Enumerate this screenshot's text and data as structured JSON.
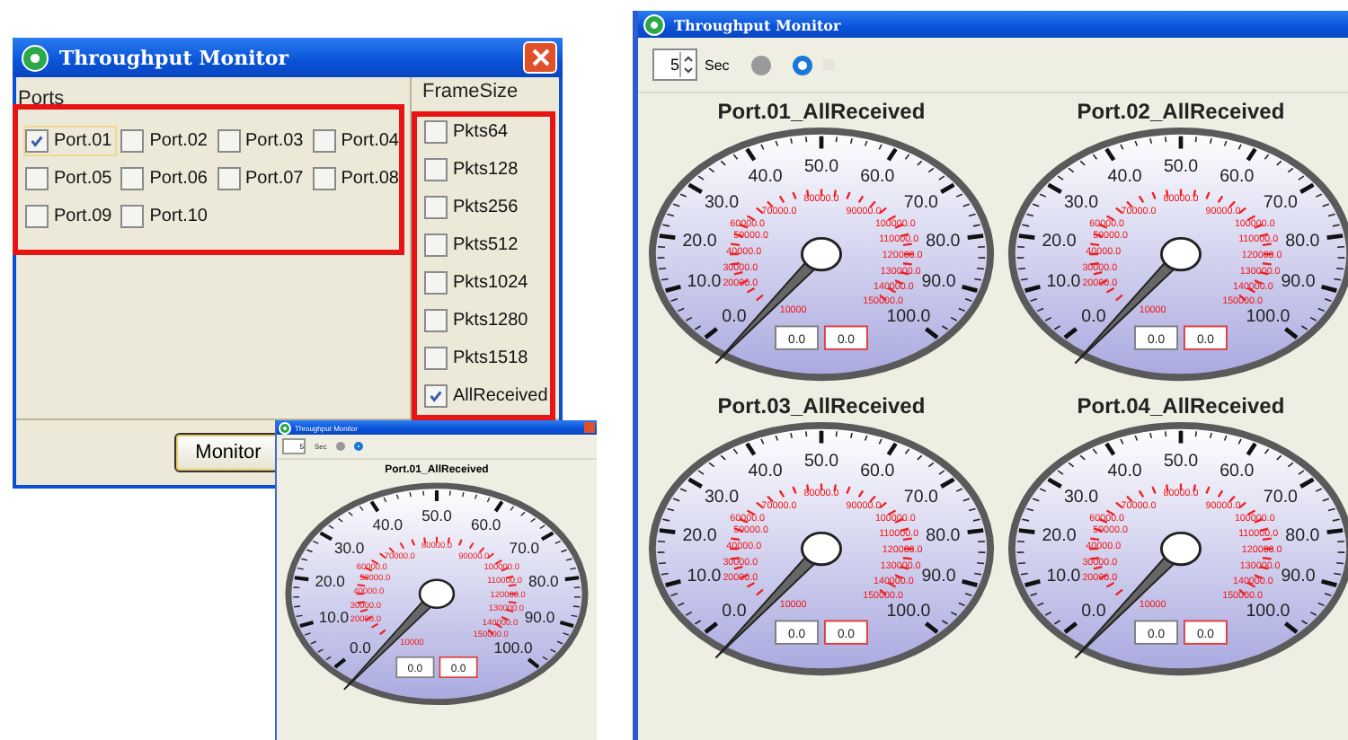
{
  "dialog": {
    "title": "Throughput Monitor",
    "ports": {
      "label": "Ports",
      "items": [
        {
          "label": "Port.01",
          "checked": true,
          "selected": true
        },
        {
          "label": "Port.02",
          "checked": false,
          "selected": false
        },
        {
          "label": "Port.03",
          "checked": false,
          "selected": false
        },
        {
          "label": "Port.04",
          "checked": false,
          "selected": false
        },
        {
          "label": "Port.05",
          "checked": false,
          "selected": false
        },
        {
          "label": "Port.06",
          "checked": false,
          "selected": false
        },
        {
          "label": "Port.07",
          "checked": false,
          "selected": false
        },
        {
          "label": "Port.08",
          "checked": false,
          "selected": false
        },
        {
          "label": "Port.09",
          "checked": false,
          "selected": false
        },
        {
          "label": "Port.10",
          "checked": false,
          "selected": false
        }
      ]
    },
    "framesize": {
      "label": "FrameSize",
      "items": [
        {
          "label": "Pkts64",
          "checked": false
        },
        {
          "label": "Pkts128",
          "checked": false
        },
        {
          "label": "Pkts256",
          "checked": false
        },
        {
          "label": "Pkts512",
          "checked": false
        },
        {
          "label": "Pkts1024",
          "checked": false
        },
        {
          "label": "Pkts1280",
          "checked": false
        },
        {
          "label": "Pkts1518",
          "checked": false
        },
        {
          "label": "AllReceived",
          "checked": true
        }
      ]
    },
    "button": "Monitor"
  },
  "small_window": {
    "title": "Throughput Monitor",
    "interval": "5",
    "unit": "Sec",
    "indicators": [
      {
        "on": false
      },
      {
        "on": true
      }
    ],
    "gauges": [
      {
        "title": "Port.01_AllReceived",
        "scale_labels": [
          "0.0",
          "10.0",
          "20.0",
          "30.0",
          "40.0",
          "50.0",
          "60.0",
          "70.0",
          "80.0",
          "90.0",
          "100.0"
        ],
        "inner_labels": [
          "80000.0",
          "70000.0",
          "90000.0",
          "60000.0",
          "100000.0",
          "50000.0",
          "110000.0",
          "40000.0",
          "120000.0",
          "30000.0",
          "130000.0",
          "20000.0",
          "140000.0",
          "150000.0",
          "10000"
        ],
        "readouts": [
          {
            "value": "0.0",
            "kind": "plain"
          },
          {
            "value": "0.0",
            "kind": "alert"
          }
        ]
      }
    ]
  },
  "main_window": {
    "title": "Throughput Monitor",
    "interval": "5",
    "unit": "Sec",
    "indicators": [
      {
        "on": false
      },
      {
        "on": true
      }
    ],
    "gauges": [
      {
        "title": "Port.01_AllReceived",
        "scale_labels": [
          "0.0",
          "10.0",
          "20.0",
          "30.0",
          "40.0",
          "50.0",
          "60.0",
          "70.0",
          "80.0",
          "90.0",
          "100.0"
        ],
        "inner_labels": [
          "80000.0",
          "70000.0",
          "90000.0",
          "60000.0",
          "100000.0",
          "50000.0",
          "110000.0",
          "40000.0",
          "120000.0",
          "30000.0",
          "130000.0",
          "20000.0",
          "140000.0",
          "150000.0",
          "10000"
        ],
        "readouts": [
          {
            "value": "0.0",
            "kind": "plain"
          },
          {
            "value": "0.0",
            "kind": "alert"
          }
        ]
      },
      {
        "title": "Port.02_AllReceived",
        "scale_labels": [
          "0.0",
          "10.0",
          "20.0",
          "30.0",
          "40.0",
          "50.0",
          "60.0",
          "70.0",
          "80.0",
          "90.0",
          "100.0"
        ],
        "inner_labels": [
          "80000.0",
          "70000.0",
          "90000.0",
          "60000.0",
          "100000.0",
          "50000.0",
          "110000.0",
          "40000.0",
          "120000.0",
          "30000.0",
          "130000.0",
          "20000.0",
          "140000.0",
          "150000.0",
          "10000"
        ],
        "readouts": [
          {
            "value": "0.0",
            "kind": "plain"
          },
          {
            "value": "0.0",
            "kind": "alert"
          }
        ]
      },
      {
        "title": "Port.03_AllReceived",
        "scale_labels": [
          "0.0",
          "10.0",
          "20.0",
          "30.0",
          "40.0",
          "50.0",
          "60.0",
          "70.0",
          "80.0",
          "90.0",
          "100.0"
        ],
        "inner_labels": [
          "80000.0",
          "70000.0",
          "90000.0",
          "60000.0",
          "100000.0",
          "50000.0",
          "110000.0",
          "40000.0",
          "120000.0",
          "30000.0",
          "130000.0",
          "20000.0",
          "140000.0",
          "150000.0",
          "10000"
        ],
        "readouts": [
          {
            "value": "0.0",
            "kind": "plain"
          },
          {
            "value": "0.0",
            "kind": "alert"
          }
        ]
      },
      {
        "title": "Port.04_AllReceived",
        "scale_labels": [
          "0.0",
          "10.0",
          "20.0",
          "30.0",
          "40.0",
          "50.0",
          "60.0",
          "70.0",
          "80.0",
          "90.0",
          "100.0"
        ],
        "inner_labels": [
          "80000.0",
          "70000.0",
          "90000.0",
          "60000.0",
          "100000.0",
          "50000.0",
          "110000.0",
          "40000.0",
          "120000.0",
          "30000.0",
          "130000.0",
          "20000.0",
          "140000.0",
          "150000.0",
          "10000"
        ],
        "readouts": [
          {
            "value": "0.0",
            "kind": "plain"
          },
          {
            "value": "0.0",
            "kind": "alert"
          }
        ]
      }
    ]
  }
}
